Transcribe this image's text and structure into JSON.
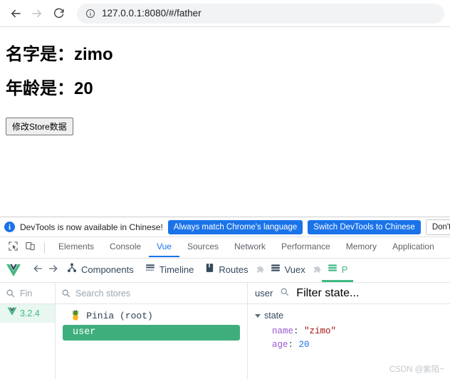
{
  "browser": {
    "back_icon": "arrow-left-icon",
    "forward_icon": "arrow-right-icon",
    "reload_icon": "reload-icon",
    "site_info_icon": "info-circle-icon",
    "url": "127.0.0.1:8080/#/father"
  },
  "page": {
    "name_line": "名字是：zimo",
    "age_line": "年龄是：20",
    "button_label": "修改Store数据"
  },
  "devtools": {
    "banner": {
      "info_icon": "info-icon",
      "message": "DevTools is now available in Chinese!",
      "primary_button_1": "Always match Chrome's language",
      "primary_button_2": "Switch DevTools to Chinese",
      "secondary_button": "Don't sh"
    },
    "toolbar_icons": {
      "inspect": "inspect-element-icon",
      "device": "device-toolbar-icon"
    },
    "tabs": [
      {
        "label": "Elements",
        "active": false
      },
      {
        "label": "Console",
        "active": false
      },
      {
        "label": "Vue",
        "active": true
      },
      {
        "label": "Sources",
        "active": false
      },
      {
        "label": "Network",
        "active": false
      },
      {
        "label": "Performance",
        "active": false
      },
      {
        "label": "Memory",
        "active": false
      },
      {
        "label": "Application",
        "active": false
      }
    ]
  },
  "vue_devtools": {
    "logo_icon": "vue-logo-icon",
    "back_icon": "arrow-left-icon",
    "forward_icon": "arrow-right-icon",
    "nav": [
      {
        "label": "Components",
        "icon": "components-tree-icon",
        "plugin": false,
        "active": false
      },
      {
        "label": "Timeline",
        "icon": "timeline-icon",
        "plugin": false,
        "active": false
      },
      {
        "label": "Routes",
        "icon": "routes-book-icon",
        "plugin": true,
        "active": false
      },
      {
        "label": "Vuex",
        "icon": "vuex-stack-icon",
        "plugin": true,
        "active": false
      },
      {
        "label": "P",
        "icon": "pinia-stack-icon",
        "plugin": false,
        "active": true
      }
    ],
    "components_panel": {
      "search_placeholder": "Fin",
      "search_icon": "search-icon",
      "row_icon": "vue-logo-icon",
      "row_label": "3.2.4"
    },
    "stores_panel": {
      "search_placeholder": "Search stores",
      "search_icon": "search-icon",
      "root_icon": "pineapple-icon",
      "root_label": "Pinia (root)",
      "selected_store": "user"
    },
    "detail_panel": {
      "title": "user",
      "filter_placeholder": "Filter state...",
      "filter_icon": "search-icon",
      "state_label": "state",
      "state_expanded": true,
      "props": [
        {
          "key": "name",
          "value": "\"zimo\"",
          "type": "string"
        },
        {
          "key": "age",
          "value": "20",
          "type": "number"
        }
      ]
    }
  },
  "watermark": "CSDN @紫陌~",
  "colors": {
    "vue_green": "#42b883",
    "store_green": "#3eaf7c",
    "chrome_blue": "#1a73e8",
    "string_red": "#a31515",
    "key_purple": "#9b59d0",
    "number_blue": "#1f6feb"
  }
}
